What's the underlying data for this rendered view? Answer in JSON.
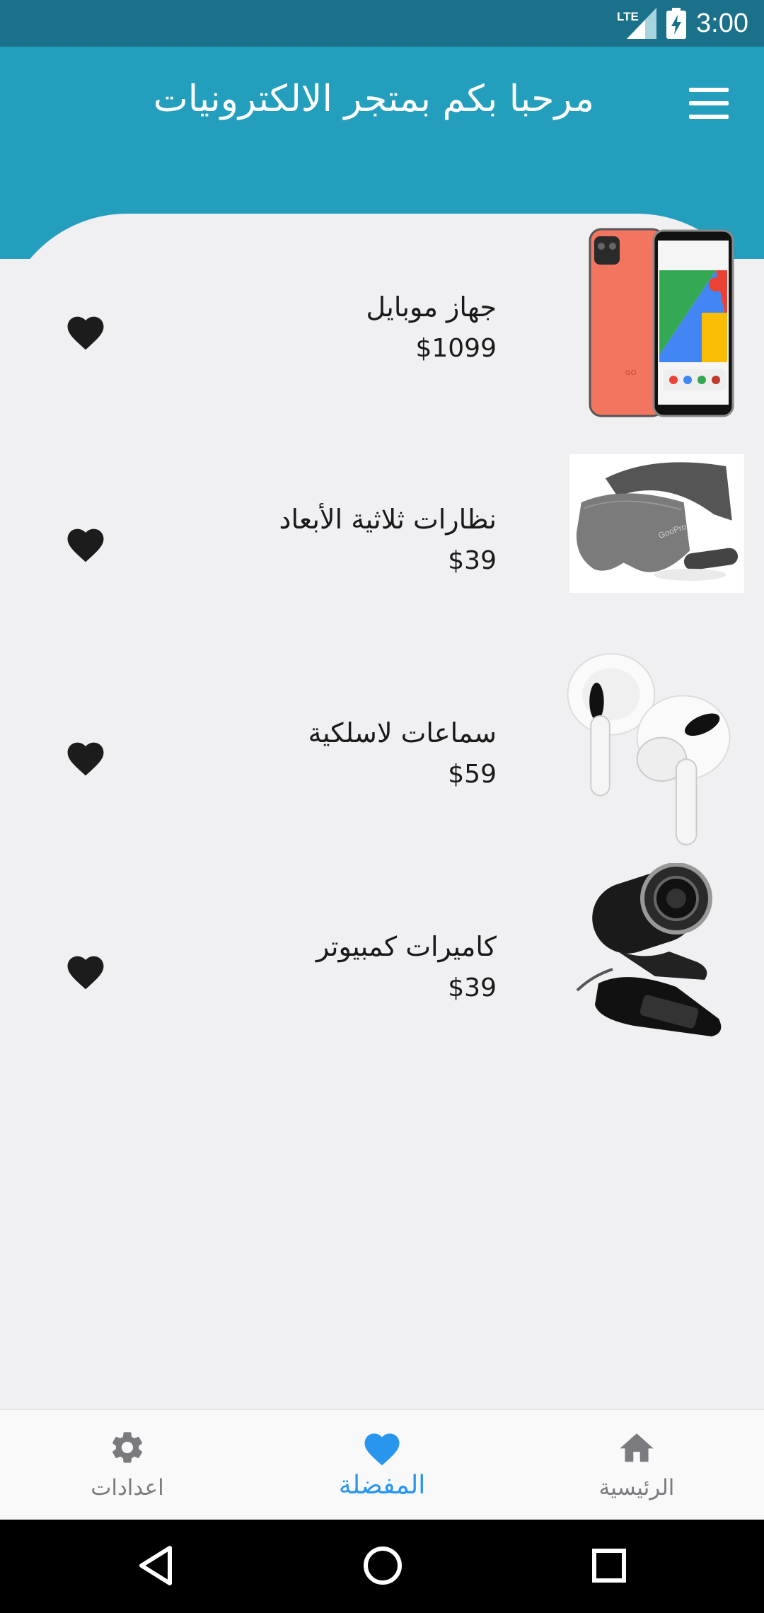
{
  "status_bar": {
    "network": "LTE",
    "time": "3:00"
  },
  "app_bar": {
    "title": "مرحبا بكم بمتجر الالكترونيات",
    "menu_icon": "menu-icon"
  },
  "products": [
    {
      "name": "جهاز موبايل",
      "price": "$1099",
      "image": "phone-image"
    },
    {
      "name": "نظارات ثلاثية الأبعاد",
      "price": "$39",
      "image": "vr-headset-image"
    },
    {
      "name": "سماعات لاسلكية",
      "price": "$59",
      "image": "earbuds-image"
    },
    {
      "name": "كاميرات كمبيوتر",
      "price": "$39",
      "image": "webcam-image"
    }
  ],
  "bottom_nav": {
    "items": [
      {
        "label": "الرئيسية",
        "icon": "home-icon",
        "active": false
      },
      {
        "label": "المفضلة",
        "icon": "heart-icon",
        "active": true
      },
      {
        "label": "اعدادات",
        "icon": "gear-icon",
        "active": false
      }
    ]
  },
  "colors": {
    "status_bar": "#1b7189",
    "app_bar": "#239fbd",
    "background": "#f0eff2",
    "active_nav": "#2996ee",
    "inactive_nav": "#7b7b7f"
  }
}
